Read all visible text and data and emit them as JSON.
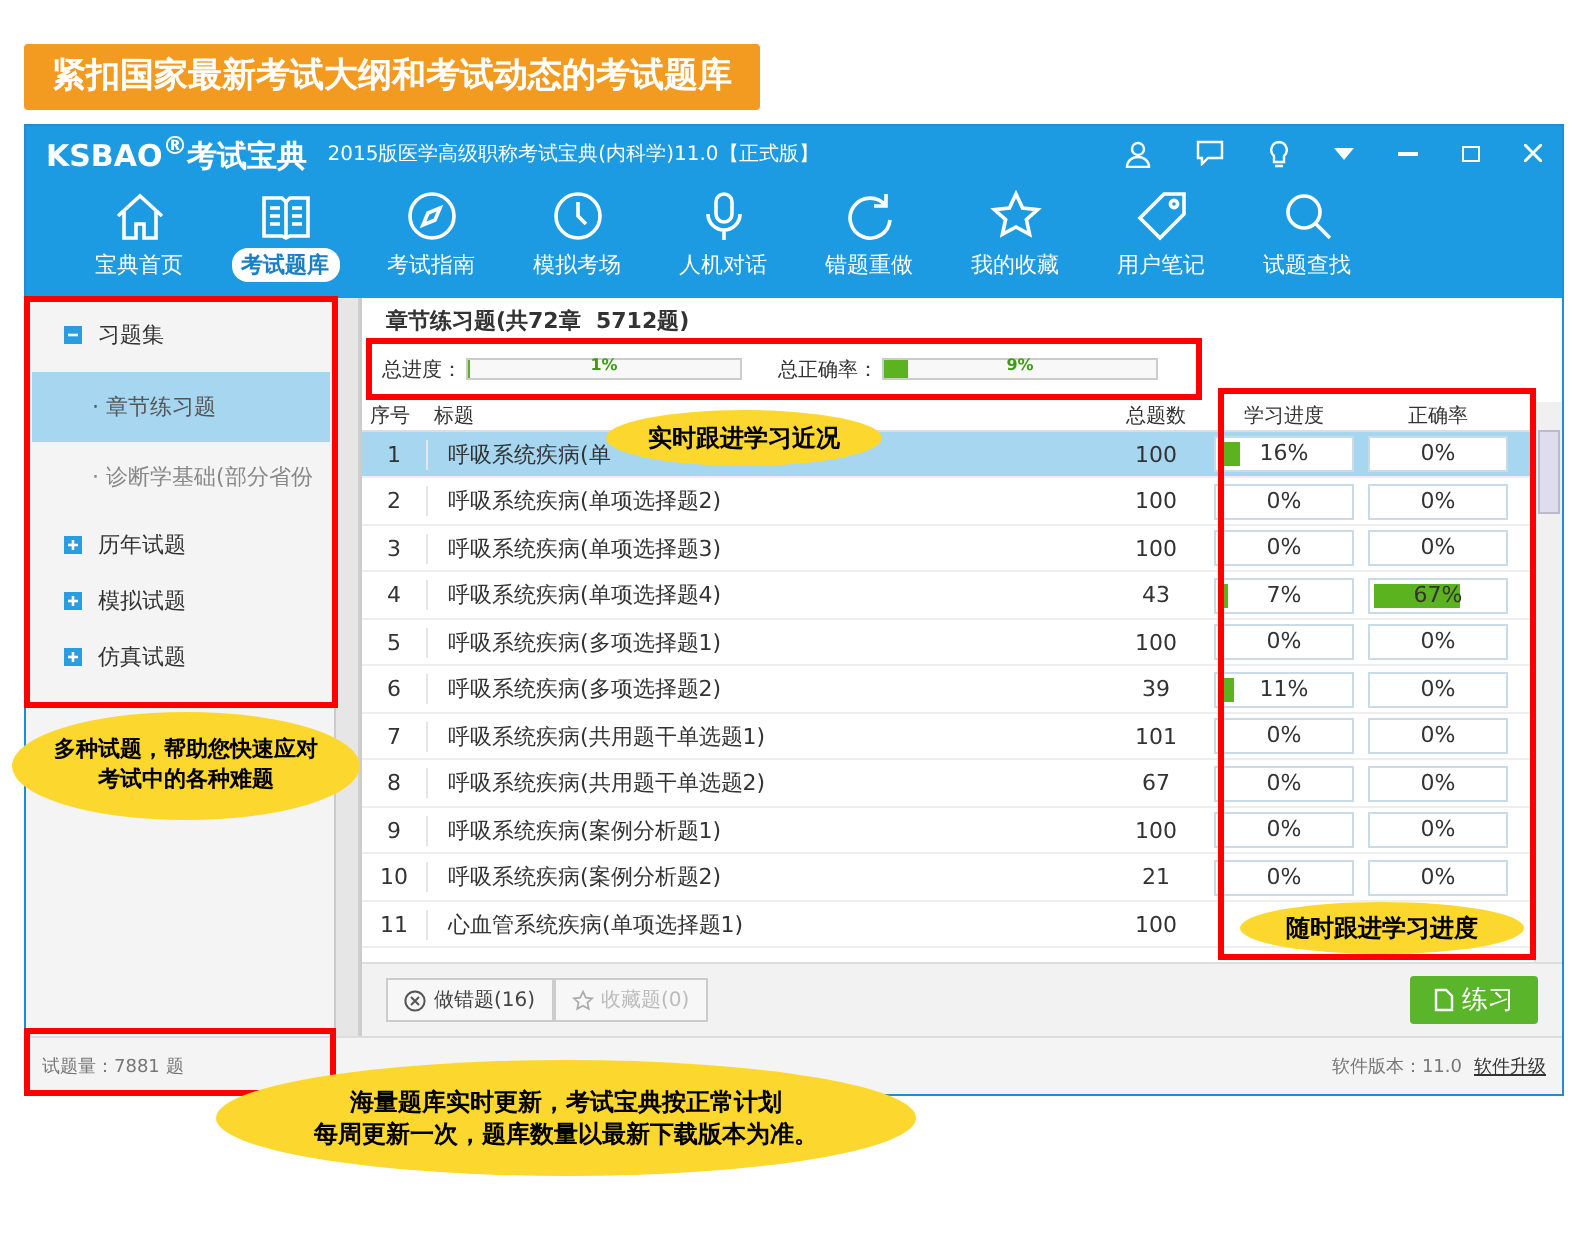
{
  "banner": {
    "title": "紧扣国家最新考试大纲和考试动态的考试题库"
  },
  "window": {
    "logo": "KSBAO$^{®}$考试宝典",
    "title": "2015版医学高级职称考试宝典(内科学)11.0【正式版】"
  },
  "nav": [
    {
      "label": "宝典首页",
      "selected": false
    },
    {
      "label": "考试题库",
      "selected": true
    },
    {
      "label": "考试指南",
      "selected": false
    },
    {
      "label": "模拟考场",
      "selected": false
    },
    {
      "label": "人机对话",
      "selected": false
    },
    {
      "label": "错题重做",
      "selected": false
    },
    {
      "label": "我的收藏",
      "selected": false
    },
    {
      "label": "用户笔记",
      "selected": false
    },
    {
      "label": "试题查找",
      "selected": false
    }
  ],
  "sidebar": {
    "items": [
      {
        "label": "习题集",
        "expanded": true,
        "children": [
          {
            "label": "· 章节练习题",
            "selected": true
          },
          {
            "label": "· 诊断学基础(部分省份",
            "selected": false
          }
        ]
      },
      {
        "label": "历年试题",
        "expanded": false
      },
      {
        "label": "模拟试题",
        "expanded": false
      },
      {
        "label": "仿真试题",
        "expanded": false
      }
    ]
  },
  "section_title": "章节练习题(共72章  5712题)",
  "totals": [
    {
      "label": "总进度：",
      "level": 0.01,
      "reading": "1%"
    },
    {
      "label": "总正确率：",
      "level": 0.09,
      "reading": "9%"
    }
  ],
  "table": {
    "columns": [
      "序号",
      "标题",
      "总题数",
      "学习进度",
      "正确率"
    ],
    "rows": [
      {
        "seq": "1",
        "title": "呼吸系统疾病(单",
        "count": "100",
        "progress": {
          "level": 0.16,
          "reading": "16%"
        },
        "accuracy": {
          "level": 0,
          "reading": "0%"
        },
        "selected": true
      },
      {
        "seq": "2",
        "title": "呼吸系统疾病(单项选择题2)",
        "count": "100",
        "progress": {
          "level": 0,
          "reading": "0%"
        },
        "accuracy": {
          "level": 0,
          "reading": "0%"
        },
        "selected": false
      },
      {
        "seq": "3",
        "title": "呼吸系统疾病(单项选择题3)",
        "count": "100",
        "progress": {
          "level": 0,
          "reading": "0%"
        },
        "accuracy": {
          "level": 0,
          "reading": "0%"
        },
        "selected": false
      },
      {
        "seq": "4",
        "title": "呼吸系统疾病(单项选择题4)",
        "count": "43",
        "progress": {
          "level": 0.07,
          "reading": "7%"
        },
        "accuracy": {
          "level": 0.67,
          "reading": "67%"
        },
        "selected": false
      },
      {
        "seq": "5",
        "title": "呼吸系统疾病(多项选择题1)",
        "count": "100",
        "progress": {
          "level": 0,
          "reading": "0%"
        },
        "accuracy": {
          "level": 0,
          "reading": "0%"
        },
        "selected": false
      },
      {
        "seq": "6",
        "title": "呼吸系统疾病(多项选择题2)",
        "count": "39",
        "progress": {
          "level": 0.11,
          "reading": "11%"
        },
        "accuracy": {
          "level": 0,
          "reading": "0%"
        },
        "selected": false
      },
      {
        "seq": "7",
        "title": "呼吸系统疾病(共用题干单选题1)",
        "count": "101",
        "progress": {
          "level": 0,
          "reading": "0%"
        },
        "accuracy": {
          "level": 0,
          "reading": "0%"
        },
        "selected": false
      },
      {
        "seq": "8",
        "title": "呼吸系统疾病(共用题干单选题2)",
        "count": "67",
        "progress": {
          "level": 0,
          "reading": "0%"
        },
        "accuracy": {
          "level": 0,
          "reading": "0%"
        },
        "selected": false
      },
      {
        "seq": "9",
        "title": "呼吸系统疾病(案例分析题1)",
        "count": "100",
        "progress": {
          "level": 0,
          "reading": "0%"
        },
        "accuracy": {
          "level": 0,
          "reading": "0%"
        },
        "selected": false
      },
      {
        "seq": "10",
        "title": "呼吸系统疾病(案例分析题2)",
        "count": "21",
        "progress": {
          "level": 0,
          "reading": "0%"
        },
        "accuracy": {
          "level": 0,
          "reading": "0%"
        },
        "selected": false
      },
      {
        "seq": "11",
        "title": "心血管系统疾病(单项选择题1)",
        "count": "100",
        "progress": null,
        "accuracy": null,
        "selected": false
      }
    ]
  },
  "filters": [
    {
      "label": "做错题(16)",
      "disabled": false
    },
    {
      "label": "收藏题(0)",
      "disabled": true
    }
  ],
  "practice_button": "练习",
  "status": {
    "count": "试题量：7881 题",
    "version": "软件版本：11.0",
    "upgrade_link": "软件升级"
  },
  "callouts": [
    {
      "lines": [
        "实时跟进学习近况"
      ]
    },
    {
      "lines": [
        "多种试题，帮助您快速应对",
        "考试中的各种难题"
      ]
    },
    {
      "lines": [
        "随时跟进学习进度"
      ]
    },
    {
      "lines": [
        "海量题库实时更新，考试宝典按正常计划",
        "每周更新一次，题库数量以最新下载版本为准。"
      ]
    }
  ]
}
